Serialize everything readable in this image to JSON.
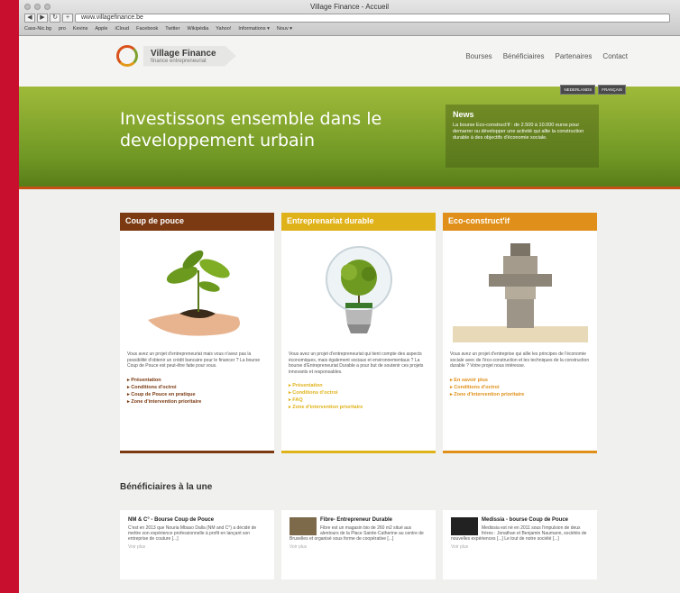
{
  "window": {
    "title": "Village Finance - Accueil",
    "url": "www.villagefinance.be"
  },
  "bookmarks": [
    "Cass-Nic.bg",
    "pro",
    "Kevins",
    "Apple",
    "iCloud",
    "Facebook",
    "Twitter",
    "Wikipédia",
    "Yahoo!",
    "Informations ▾",
    "Nouv ▾"
  ],
  "logo": {
    "name": "Village Finance",
    "tagline": "finance entrepreneuriat"
  },
  "nav": [
    "Bourses",
    "Bénéficiaires",
    "Partenaires",
    "Contact"
  ],
  "lang": [
    "NEDERLANDS",
    "FRANÇAIS"
  ],
  "hero": {
    "title": "Investissons ensemble dans le developpement urbain"
  },
  "news": {
    "title": "News",
    "text": "La bourse Eco-construct'if : de 2.500 à 10.000 euros pour demarrer ou développer une activité qui allie la construction durable à des objectifs d'économie sociale."
  },
  "cards": [
    {
      "title": "Coup de pouce",
      "color": "#7b3a12",
      "linkcolor": "#7b3a12",
      "text": "Vous avez un projet d'entrepreneuriat mais vous n'avez pas la possibilité d'obtenir un crédit bancaire pour le financer ? La bourse Coup de Pouce est peut-être faite pour vous.",
      "links": [
        "Présentation",
        "Conditions d'octroi",
        "Coup de Pouce en pratique",
        "Zone d'intervention prioritaire"
      ]
    },
    {
      "title": "Entreprenariat durable",
      "color": "#e0b21a",
      "linkcolor": "#e0b21a",
      "text": "Vous avez un projet d'entrepreneuriat qui tient compte des aspects économiques, mais également sociaux et environnementaux ? La bourse d'Entrepreneuriat Durable a pour but de soutenir ces projets innovants et responsables.",
      "links": [
        "Présentation",
        "Conditions d'octroi",
        "FAQ",
        "Zone d'intervention prioritaire"
      ]
    },
    {
      "title": "Eco-construct'if",
      "color": "#e0901a",
      "linkcolor": "#e0901a",
      "text": "Vous avez un projet d'entreprise qui allie les principes de l'économie sociale avec de l'éco-construction et les techniques de la construction durable ? Votre projet nous intéresse.",
      "links": [
        "En savoir plus",
        "Conditions d'octroi",
        "Zone d'intervention prioritaire"
      ]
    }
  ],
  "section_title": "Bénéficiaires à la une",
  "beneficiaries": [
    {
      "title": "NM & C° - Bourse Coup de Pouce",
      "text": "C'est en 2013 que Nouria Mbaso Dalla (NM and C°) a décidé de mettre son expérience professionnelle à profit en lançant son entreprise de couture [...]",
      "more": "Voir plus"
    },
    {
      "title": "Fibre- Entrepreneur Durable",
      "text": "Fibre est un magasin bio de 260 m2 situé aux alentours de la Place Sainte-Catherine au centre de Bruxelles et organisé sous forme de coopérative [...]",
      "more": "Voir plus"
    },
    {
      "title": "Medissia - bourse Coup de Pouce",
      "text": "Medissia est né en 2011 sous l'impulsion de deux frères : Jonathan et Benjamin Naumann, sociétés de nouvelles expériences [...] Le tout de notre société [...]",
      "more": "Voir plus"
    }
  ]
}
